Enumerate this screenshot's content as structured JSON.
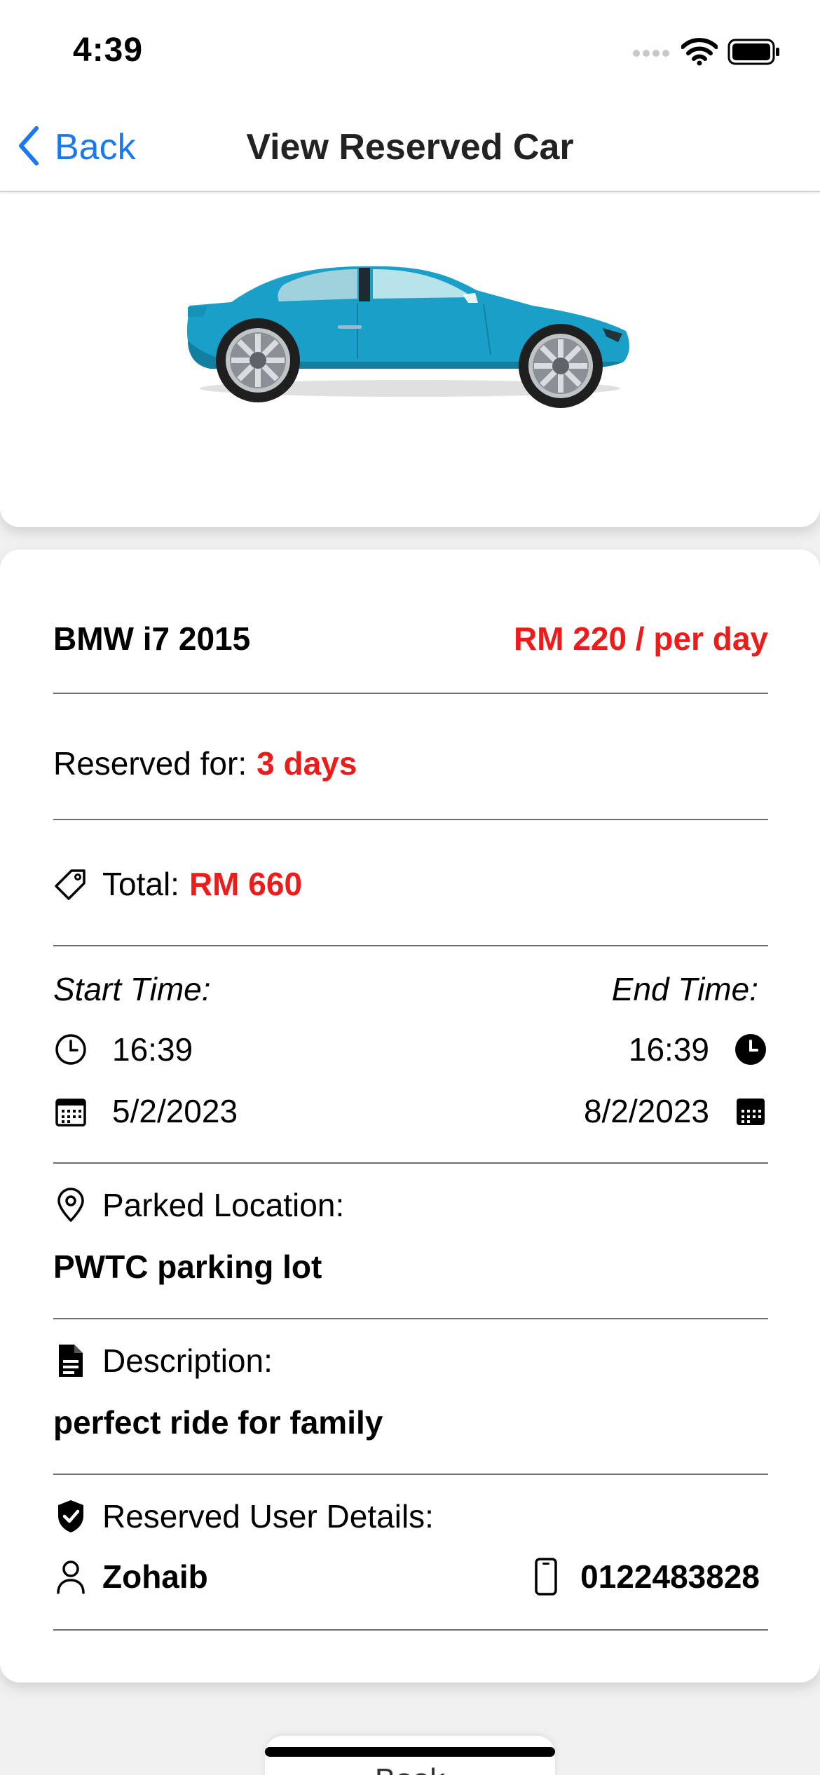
{
  "status_bar": {
    "time": "4:39",
    "icons": [
      "cellular-signal-icon",
      "wifi-icon",
      "battery-icon"
    ]
  },
  "nav": {
    "back_label": "Back",
    "title": "View Reserved Car"
  },
  "car": {
    "image_alt": "car-illustration",
    "body_color": "#1aa0c8",
    "name": "BMW i7 2015",
    "price": "RM 220 / per day"
  },
  "reservation": {
    "reserved_for_label": "Reserved for:",
    "reserved_for_value": "3 days",
    "total_label": "Total:",
    "total_value": "RM 660"
  },
  "times": {
    "start_label": "Start Time:",
    "end_label": "End Time:",
    "start_time": "16:39",
    "end_time": "16:39",
    "start_date": "5/2/2023",
    "end_date": "8/2/2023"
  },
  "location": {
    "label": "Parked Location:",
    "value": "PWTC parking lot"
  },
  "description": {
    "label": "Description:",
    "value": "perfect ride for family"
  },
  "user": {
    "label": "Reserved User Details:",
    "name": "Zohaib",
    "phone": "0122483828"
  },
  "bottom_button": {
    "label": "Book"
  },
  "colors": {
    "accent": "#1a78f0",
    "highlight_red": "#ee1b1b"
  }
}
